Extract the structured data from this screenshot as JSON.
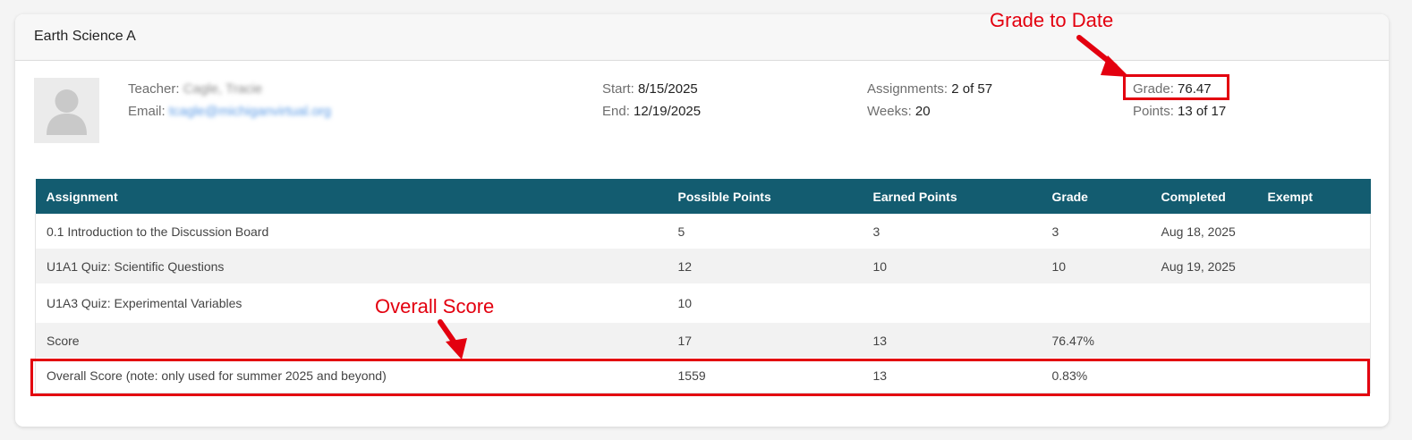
{
  "course": {
    "title": "Earth Science A"
  },
  "teacher": {
    "teacher_label": "Teacher:",
    "teacher_name": "Cagle, Tracie",
    "email_label": "Email:",
    "email": "tcagle@michiganvirtual.org"
  },
  "dates": {
    "start_label": "Start:",
    "start": "8/15/2025",
    "end_label": "End:",
    "end": "12/19/2025"
  },
  "progress": {
    "assignments_label": "Assignments:",
    "assignments": "2 of 57",
    "weeks_label": "Weeks:",
    "weeks": "20"
  },
  "grade": {
    "grade_label": "Grade:",
    "grade": "76.47",
    "points_label": "Points:",
    "points": "13 of 17"
  },
  "table": {
    "headers": [
      "Assignment",
      "Possible Points",
      "Earned Points",
      "Grade",
      "Completed",
      "Exempt"
    ],
    "rows": [
      [
        "0.1 Introduction to the Discussion Board",
        "5",
        "3",
        "3",
        "Aug 18, 2025",
        ""
      ],
      [
        "U1A1 Quiz: Scientific Questions",
        "12",
        "10",
        "10",
        "Aug 19, 2025",
        ""
      ],
      [
        "U1A3 Quiz: Experimental Variables",
        "10",
        "",
        "",
        "",
        ""
      ],
      [
        "Score",
        "17",
        "13",
        "76.47%",
        "",
        ""
      ],
      [
        "Overall Score (note: only used for summer 2025 and beyond)",
        "1559",
        "13",
        "0.83%",
        "",
        ""
      ]
    ]
  },
  "annotations": {
    "grade_to_date": "Grade to Date",
    "overall_score": "Overall Score",
    "color": "#e3000f"
  },
  "colors": {
    "table_header": "#135c70",
    "link": "#5a9ae6"
  }
}
